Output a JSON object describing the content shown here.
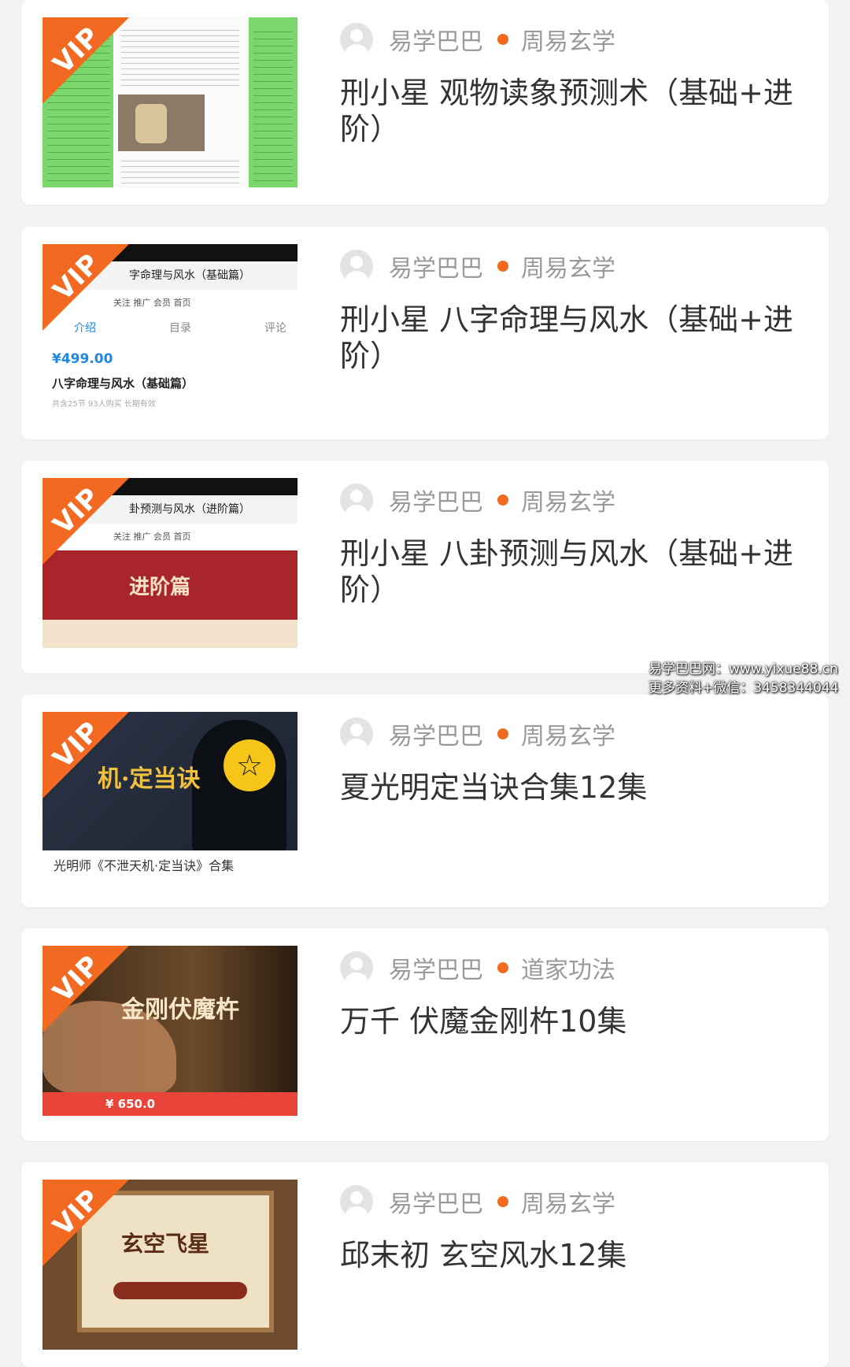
{
  "cards": [
    {
      "author": "易学巴巴",
      "category": "周易玄学",
      "title": "刑小星 观物读象预测术（基础+进阶）",
      "badge": "VIP",
      "thumb_icon": "document-page"
    },
    {
      "author": "易学巴巴",
      "category": "周易玄学",
      "title": "刑小星 八字命理与风水（基础+进阶）",
      "badge": "VIP",
      "thumb_icon": "app-screen",
      "thumb_texts": {
        "header": "字命理与风水（基础篇）",
        "icons": "关注   推广   会员   首页",
        "tabs": [
          "介绍",
          "目录",
          "评论"
        ],
        "price": "¥499.00",
        "name": "八字命理与风水（基础篇）",
        "sub": "共含25节  93人购买  长期有效"
      }
    },
    {
      "author": "易学巴巴",
      "category": "周易玄学",
      "title": "刑小星 八卦预测与风水（基础+进阶）",
      "badge": "VIP",
      "thumb_icon": "app-screen",
      "thumb_texts": {
        "header": "卦预测与风水（进阶篇）",
        "icons": "关注   推广   会员   首页",
        "banner": "进阶篇"
      }
    },
    {
      "author": "易学巴巴",
      "category": "周易玄学",
      "title": "夏光明定当诀合集12集",
      "badge": "VIP",
      "thumb_icon": "dark-poster",
      "thumb_texts": {
        "poster": "机·定当诀",
        "caption": "光明师《不泄天机·定当诀》合集"
      }
    },
    {
      "author": "易学巴巴",
      "category": "道家功法",
      "title": "万千 伏魔金刚杵10集",
      "badge": "VIP",
      "thumb_icon": "martial-poster",
      "thumb_texts": {
        "poster": "金刚伏魔杵",
        "price": "¥ 650.0"
      }
    },
    {
      "author": "易学巴巴",
      "category": "周易玄学",
      "title": "邱末初 玄空风水12集",
      "badge": "VIP",
      "thumb_icon": "wood-board",
      "thumb_texts": {
        "board": "玄空飞星"
      }
    }
  ],
  "watermark": {
    "line1": "易学巴巴网：www.yixue88.cn",
    "line2": "更多资料+微信：3458344044"
  },
  "colors": {
    "accent": "#f26a21",
    "background": "#f2f2f2",
    "card": "#ffffff",
    "title": "#333333",
    "meta": "#9a9a9a"
  }
}
